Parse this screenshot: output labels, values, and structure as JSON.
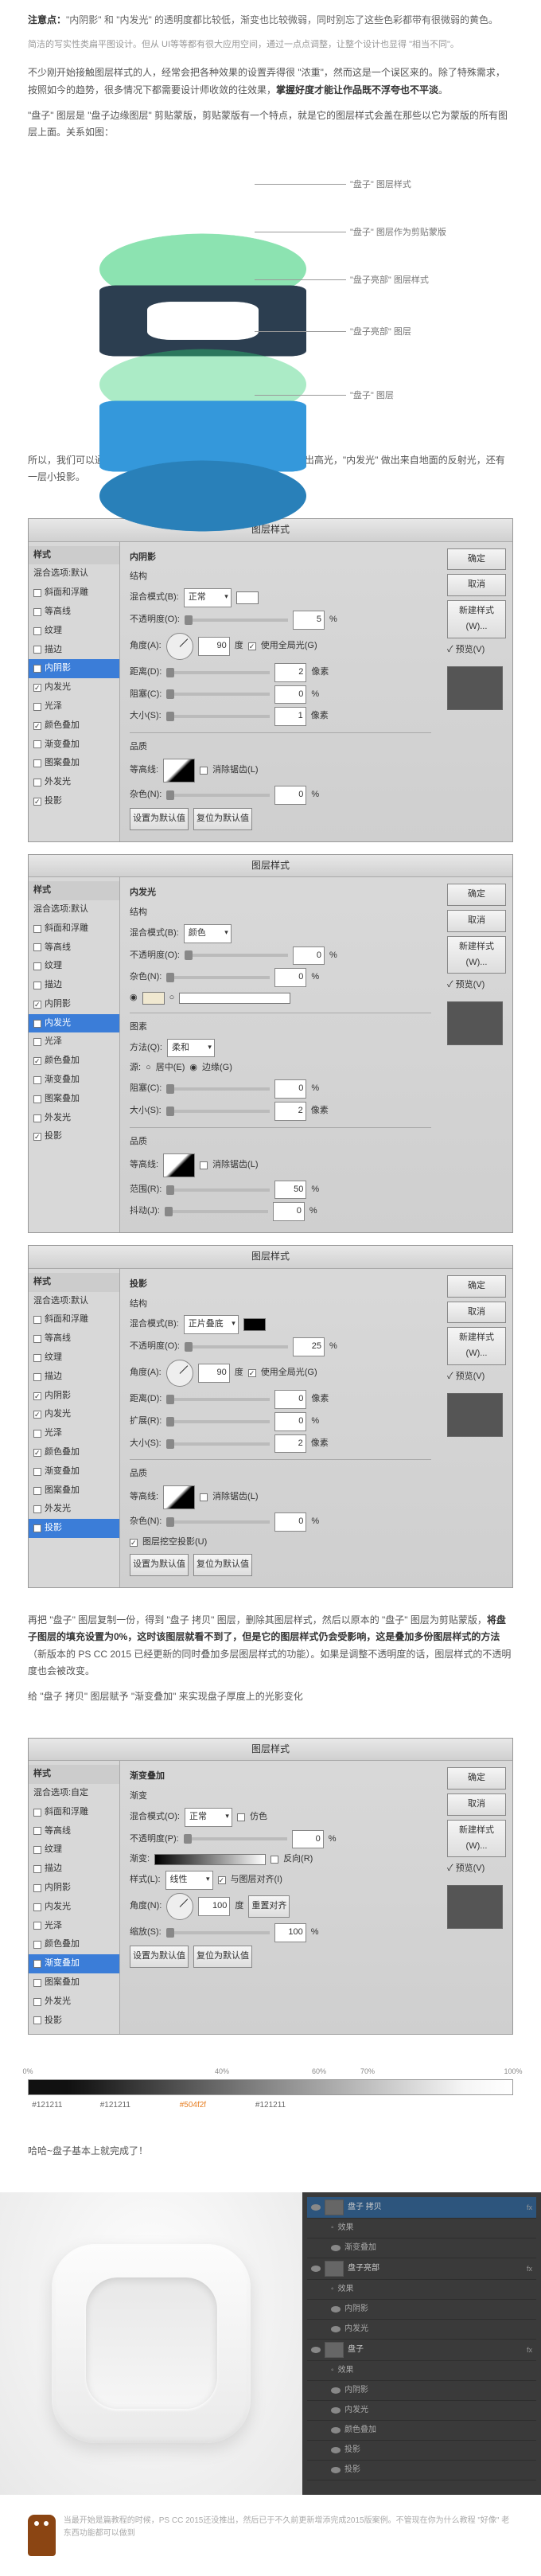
{
  "note_prefix": "注意点：",
  "note_body": "\"内阴影\" 和 \"内发光\" 的透明度都比较低，渐变也比较微弱，同时别忘了这些色彩都带有很微弱的黄色。",
  "subtitle": "简洁的写实性类扁平图设计。但从 UI等等都有很大应用空间，通过一点点调整，让整个设计也显得 \"相当不同\"。",
  "para1a": "不少刚开始接触图层样式的人，经常会把各种效果的设置弄得很 \"浓重\"，然而这是一个误区来的。除了特殊需求，按照如今的趋势，很多情况下都需要设计师收敛的往效果，",
  "para1b": "掌握好度才能让作品既不浮夸也不平淡",
  "para1c": "。",
  "para2": "\"盘子\" 图层是 \"盘子边缘图层\" 剪贴蒙版，剪贴蒙版有一个特点，就是它的图层样式会盖在那些以它为蒙版的所有图层上面。关系如图：",
  "diagram": {
    "l1": "\"盘子\" 图层样式",
    "l2": "\"盘子\" 图层作为剪贴蒙版",
    "l3": "\"盘子亮部\" 图层样式",
    "l4": "\"盘子亮部\" 图层",
    "l5": "\"盘子\" 图层"
  },
  "para3": "所以，我们可以通过盘子图层，为整个盘子添加样式。\"内阴影\" 做出高光，\"内发光\" 做出来自地面的反射光，还有一层小投影。",
  "dlg_title": "图层样式",
  "styles": {
    "hdr": "样式",
    "blend": "混合选项:默认",
    "bevel": "斜面和浮雕",
    "contour": "等高线",
    "texture": "纹理",
    "stroke": "描边",
    "inner_shadow": "内阴影",
    "inner_glow": "内发光",
    "satin": "光泽",
    "color_overlay": "颜色叠加",
    "grad_overlay": "渐变叠加",
    "pattern_overlay": "图案叠加",
    "outer_glow": "外发光",
    "drop_shadow": "投影",
    "custom": "混合选项:自定"
  },
  "btns": {
    "ok": "确定",
    "cancel": "取消",
    "new": "新建样式(W)...",
    "preview": "✓ 预览(V)",
    "defaults": "设置为默认值",
    "reset": "复位为默认值"
  },
  "d1": {
    "title": "内阴影",
    "struct": "结构",
    "blend_l": "混合模式(B):",
    "blend_v": "正常",
    "opacity_l": "不透明度(O):",
    "opacity_v": "5",
    "pct": "%",
    "angle_l": "角度(A):",
    "angle_v": "90",
    "deg": "度",
    "global": "使用全局光(G)",
    "dist_l": "距离(D):",
    "dist_v": "2",
    "px": "像素",
    "choke_l": "阻塞(C):",
    "choke_v": "0",
    "size_l": "大小(S):",
    "size_v": "1",
    "quality": "品质",
    "contour_l": "等高线:",
    "anti": "消除锯齿(L)",
    "noise_l": "杂色(N):",
    "noise_v": "0"
  },
  "d2": {
    "title": "内发光",
    "struct": "结构",
    "blend_l": "混合模式(B):",
    "blend_v": "颜色",
    "opacity_l": "不透明度(O):",
    "opacity_v": "0",
    "noise_l": "杂色(N):",
    "noise_v": "0",
    "elements": "图素",
    "tech_l": "方法(Q):",
    "tech_v": "柔和",
    "source_l": "源:",
    "center": "居中(E)",
    "edge": "边缘(G)",
    "choke_l": "阻塞(C):",
    "choke_v": "0",
    "size_l": "大小(S):",
    "size_v": "2",
    "px": "像素",
    "quality": "品质",
    "contour_l": "等高线:",
    "anti": "消除锯齿(L)",
    "range_l": "范围(R):",
    "range_v": "50",
    "jitter_l": "抖动(J):",
    "jitter_v": "0"
  },
  "d3": {
    "title": "投影",
    "struct": "结构",
    "blend_l": "混合模式(B):",
    "blend_v": "正片叠底",
    "opacity_l": "不透明度(O):",
    "opacity_v": "25",
    "angle_l": "角度(A):",
    "angle_v": "90",
    "deg": "度",
    "global": "使用全局光(G)",
    "dist_l": "距离(D):",
    "dist_v": "0",
    "px": "像素",
    "spread_l": "扩展(R):",
    "spread_v": "0",
    "size_l": "大小(S):",
    "size_v": "2",
    "quality": "品质",
    "contour_l": "等高线:",
    "anti": "消除锯齿(L)",
    "noise_l": "杂色(N):",
    "noise_v": "0",
    "knockout": "图层挖空投影(U)"
  },
  "para4a": "再把 \"盘子\" 图层复制一份，得到 \"盘子 拷贝\" 图层，删除其图层样式，然后以原本的 \"盘子\" 图层为剪贴蒙版，",
  "para4b": "将盘子图层的填充设置为0%，这时该图层就看不到了，但是它的图层样式仍会受影响，这是叠加多份图层样式的方法",
  "para4c": "（新版本的 PS CC 2015 已经更新的同时叠加多层图层样式的功能）。如果是调整不透明度的话，图层样式的不透明度也会被改变。",
  "para5": "给 \"盘子 拷贝\" 图层赋予 \"渐变叠加\" 来实现盘子厚度上的光影变化",
  "d4": {
    "title": "渐变",
    "blend_l": "混合模式(O):",
    "blend_v": "正常",
    "dither": "仿色",
    "opacity_l": "不透明度(P):",
    "opacity_v": "0",
    "grad_l": "渐变:",
    "reverse": "反向(R)",
    "style_l": "样式(L):",
    "style_v": "线性",
    "align": "与图层对齐(I)",
    "angle_l": "角度(N):",
    "angle_v": "100",
    "deg": "度",
    "reset_align": "重置对齐",
    "scale_l": "缩放(S):",
    "scale_v": "100"
  },
  "ruler": {
    "t0": "0%",
    "t40": "40%",
    "t60": "60%",
    "t70": "70%",
    "t100": "100%",
    "s1": "#121211",
    "s2": "#121211",
    "s3": "#504f2f",
    "s4": "#121211"
  },
  "para6": "哈哈~盘子基本上就完成了！",
  "layers": {
    "r1": "盘子 拷贝",
    "r1fx": "fx",
    "r1a": "效果",
    "r1b": "渐变叠加",
    "r2": "盘子亮部",
    "r2fx": "fx",
    "r2a": "效果",
    "r2b": "内阴影",
    "r2c": "内发光",
    "r3": "盘子",
    "r3fx": "fx",
    "r3a": "效果",
    "r3b": "内阴影",
    "r3c": "内发光",
    "r3d": "颜色叠加",
    "r3e": "投影",
    "r3f": "投影"
  },
  "footer": "当最开始是篇教程的时候，PS CC 2015还没推出，然后已于不久前更新增添完成2015版案例。不管现在你为什么教程 \"好像\" 老东西功能都可以做到"
}
